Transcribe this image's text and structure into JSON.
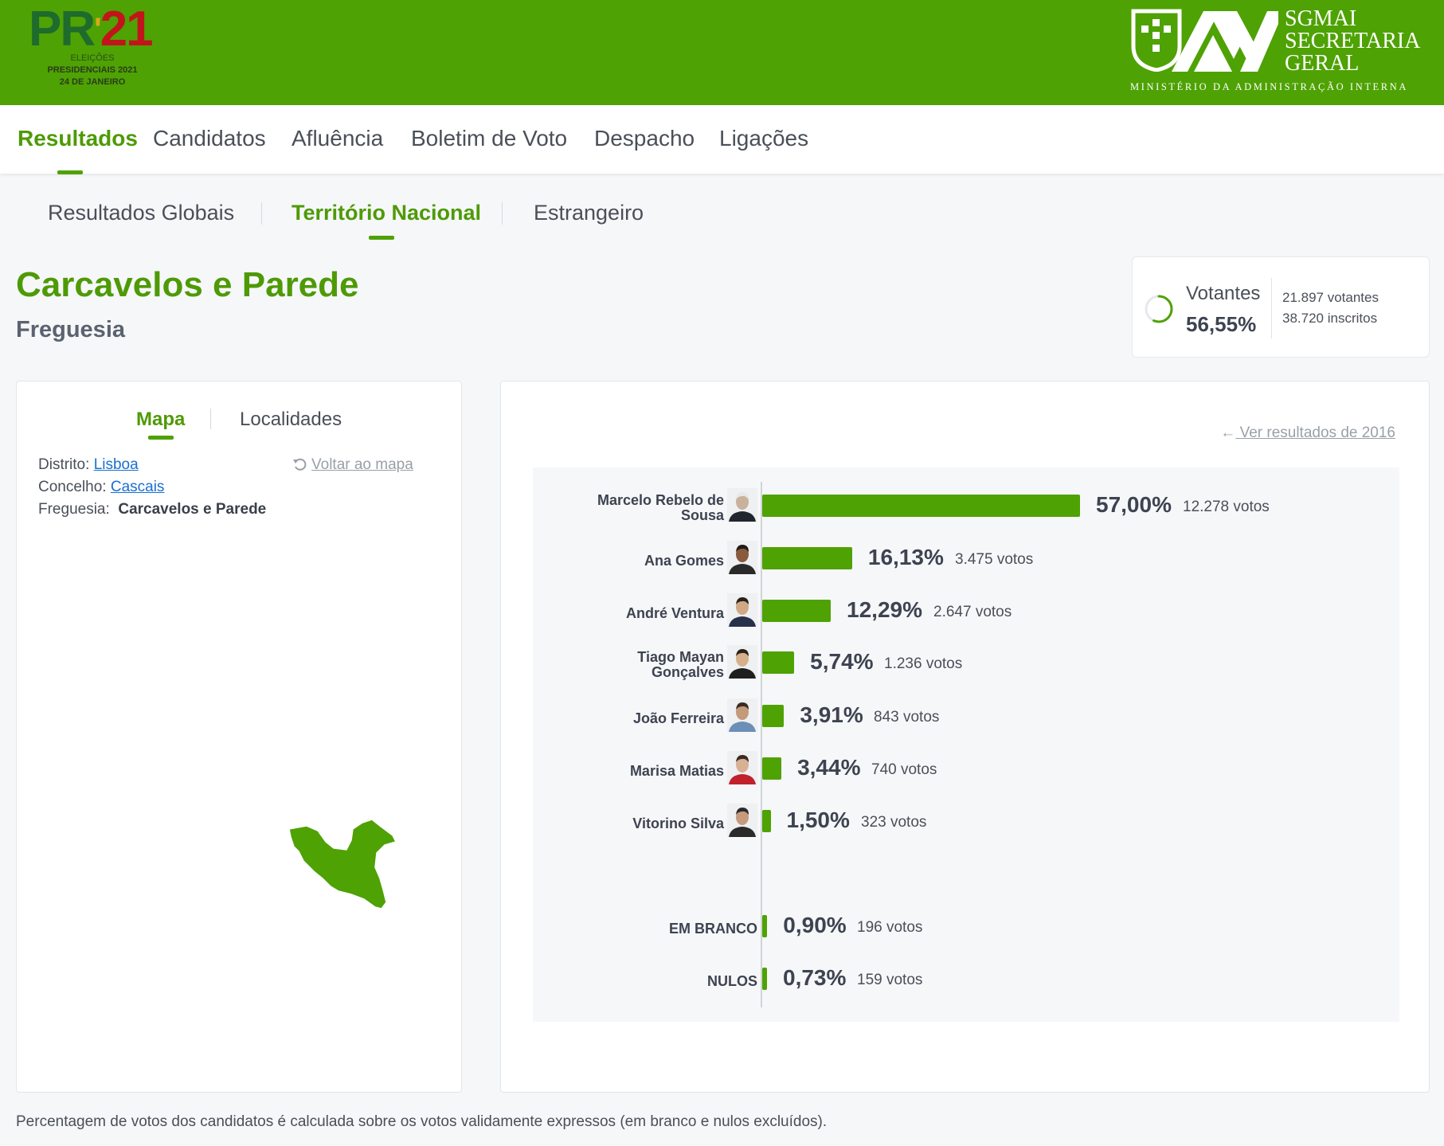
{
  "header": {
    "logo_pr": "PR",
    "logo_quote": "'",
    "logo_num": "21",
    "logo_line1": "ELEIÇÕES",
    "logo_line2": "PRESIDENCIAIS 2021",
    "logo_line3": "24 DE JANEIRO",
    "sgmai_line1": "SGMAI",
    "sgmai_line2": "SECRETARIA",
    "sgmai_line3": "GERAL",
    "ministry": "MINISTÉRIO DA ADMINISTRAÇÃO INTERNA",
    "brand_color": "#4ea203"
  },
  "nav": {
    "items": [
      {
        "label": "Resultados",
        "active": true
      },
      {
        "label": "Candidatos"
      },
      {
        "label": "Afluência"
      },
      {
        "label": "Boletim de Voto"
      },
      {
        "label": "Despacho"
      },
      {
        "label": "Ligações"
      }
    ]
  },
  "subnav": {
    "items": [
      {
        "label": "Resultados Globais"
      },
      {
        "label": "Território Nacional",
        "active": true
      },
      {
        "label": "Estrangeiro"
      }
    ]
  },
  "page": {
    "title": "Carcavelos e Parede",
    "subtitle": "Freguesia"
  },
  "votantes": {
    "label": "Votantes",
    "percent": "56,55%",
    "percent_value": 56.55,
    "voters": "21.897 votantes",
    "registered": "38.720 inscritos"
  },
  "left_panel": {
    "tabs": [
      {
        "label": "Mapa",
        "active": true
      },
      {
        "label": "Localidades"
      }
    ],
    "district_label": "Distrito:",
    "district_value": "Lisboa",
    "municipality_label": "Concelho:",
    "municipality_value": "Cascais",
    "parish_label": "Freguesia:",
    "parish_value": "Carcavelos e Parede",
    "back_link": "Voltar ao mapa",
    "back_icon": "undo-icon",
    "map_color": "#4ea203"
  },
  "right_panel": {
    "link_2016": "Ver resultados de 2016",
    "link_icon": "arrow-left-icon"
  },
  "chart_data": {
    "type": "bar",
    "orientation": "horizontal",
    "categories": [
      "Marcelo Rebelo de Sousa",
      "Ana Gomes",
      "André Ventura",
      "Tiago Mayan Gonçalves",
      "João Ferreira",
      "Marisa Matias",
      "Vitorino Silva",
      "EM BRANCO",
      "NULOS"
    ],
    "values": [
      57.0,
      16.13,
      12.29,
      5.74,
      3.91,
      3.44,
      1.5,
      0.9,
      0.73
    ],
    "percent_labels": [
      "57,00%",
      "16,13%",
      "12,29%",
      "5,74%",
      "3,91%",
      "3,44%",
      "1,50%",
      "0,90%",
      "0,73%"
    ],
    "votes": [
      12278,
      3475,
      2647,
      1236,
      843,
      740,
      323,
      196,
      159
    ],
    "vote_labels": [
      "12.278 votos",
      "3.475 votos",
      "2.647 votos",
      "1.236 votos",
      "843 votos",
      "740 votos",
      "323 votos",
      "196 votos",
      "159 votos"
    ],
    "name_lines": [
      [
        "Marcelo Rebelo de",
        "Sousa"
      ],
      [
        "Ana Gomes"
      ],
      [
        "André Ventura"
      ],
      [
        "Tiago Mayan",
        "Gonçalves"
      ],
      [
        "João Ferreira"
      ],
      [
        "Marisa Matias"
      ],
      [
        "Vitorino Silva"
      ],
      [
        "EM BRANCO"
      ],
      [
        "NULOS"
      ]
    ],
    "has_photo": [
      true,
      true,
      true,
      true,
      true,
      true,
      true,
      false,
      false
    ],
    "bar_color": "#4ea203",
    "xlim": [
      0,
      60
    ],
    "grid": false
  },
  "footnote": "Percentagem de votos dos candidatos é calculada sobre os votos validamente expressos (em branco e nulos excluídos)."
}
